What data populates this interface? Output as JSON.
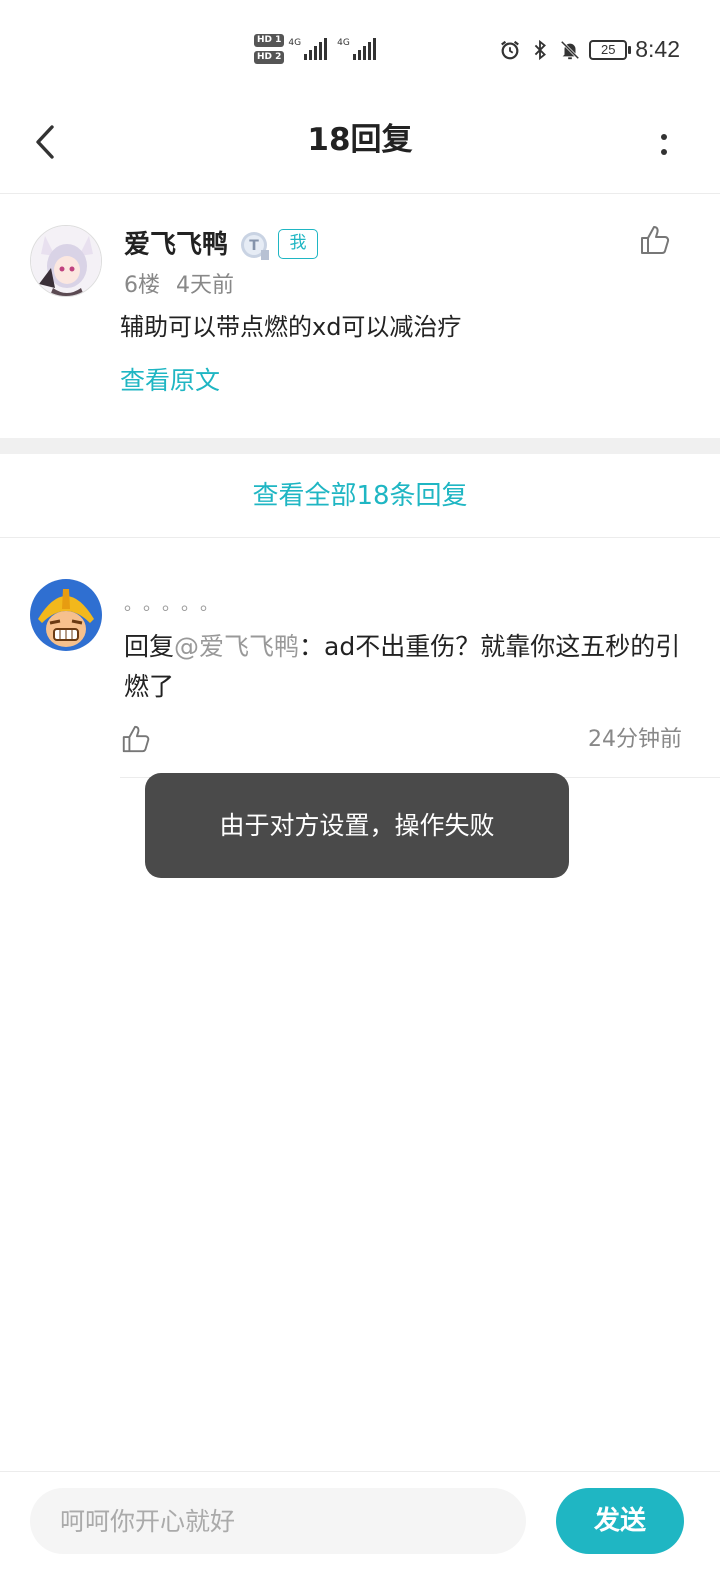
{
  "status_bar": {
    "sim1_tag": "HD 1",
    "sim2_tag": "HD 2",
    "network1": "4G",
    "network2": "4G",
    "battery": "25",
    "time": "8:42",
    "icons": [
      "alarm-icon",
      "bluetooth-icon",
      "mute-icon"
    ]
  },
  "header": {
    "title": "18回复",
    "back_icon": "chevron-left-icon",
    "more_icon": "more-vertical-icon"
  },
  "original_post": {
    "username": "爱飞飞鸭",
    "level_badge_icon": "level-badge-icon",
    "me_tag": "我",
    "floor": "6楼",
    "time": "4天前",
    "content": "辅助可以带点燃的xd可以减治疗",
    "view_original": "查看原文"
  },
  "view_all_label": "查看全部18条回复",
  "reply": {
    "username": "。。。。。",
    "prefix": "回复",
    "mention": "@爱飞飞鸭",
    "content": "：ad不出重伤？就靠你这五秒的引燃了",
    "time": "24分钟前"
  },
  "toast": {
    "message": "由于对方设置，操作失败"
  },
  "composer": {
    "placeholder": "呵呵你开心就好",
    "value": "",
    "send_label": "发送"
  },
  "colors": {
    "accent": "#1fb6c3",
    "toast_bg": "#4a4a4a",
    "separator": "#f0f0f0"
  }
}
